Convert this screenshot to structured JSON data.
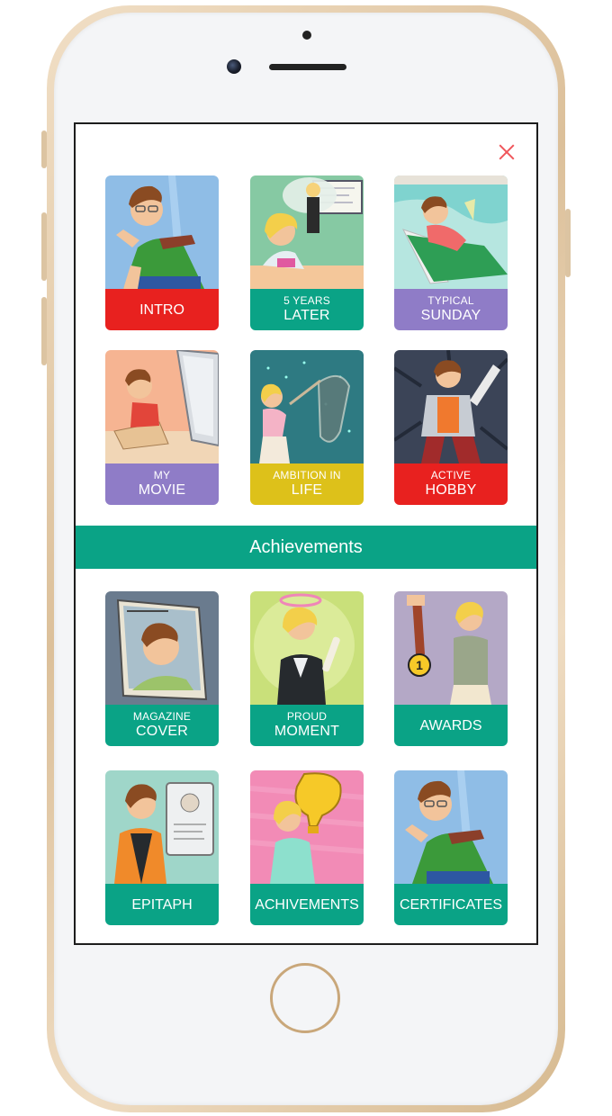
{
  "colors": {
    "green": "#0aa386",
    "red": "#e8211f",
    "purple": "#8f7cc7",
    "yellow": "#ddc11a",
    "close": "#f0565b"
  },
  "screen": {
    "close_icon": "close-icon",
    "section_title": "Achievements",
    "top_cards": [
      {
        "small": "",
        "big": "INTRO",
        "color": "red"
      },
      {
        "small": "5 YEARS",
        "big": "LATER",
        "color": "green"
      },
      {
        "small": "TYPICAL",
        "big": "SUNDAY",
        "color": "purple"
      },
      {
        "small": "MY",
        "big": "MOVIE",
        "color": "purple"
      },
      {
        "small": "AMBITION IN",
        "big": "LIFE",
        "color": "yellow"
      },
      {
        "small": "ACTIVE",
        "big": "HOBBY",
        "color": "red"
      }
    ],
    "achievement_cards": [
      {
        "small": "MAGAZINE",
        "big": "COVER",
        "color": "green"
      },
      {
        "small": "PROUD",
        "big": "MOMENT",
        "color": "green"
      },
      {
        "small": "",
        "big": "AWARDS",
        "color": "green"
      },
      {
        "small": "",
        "big": "EPITAPH",
        "color": "green"
      },
      {
        "small": "",
        "big": "ACHIVEMENTS",
        "color": "green"
      },
      {
        "small": "",
        "big": "CERTIFICATES",
        "color": "green"
      }
    ],
    "award_medal_number": "1"
  }
}
